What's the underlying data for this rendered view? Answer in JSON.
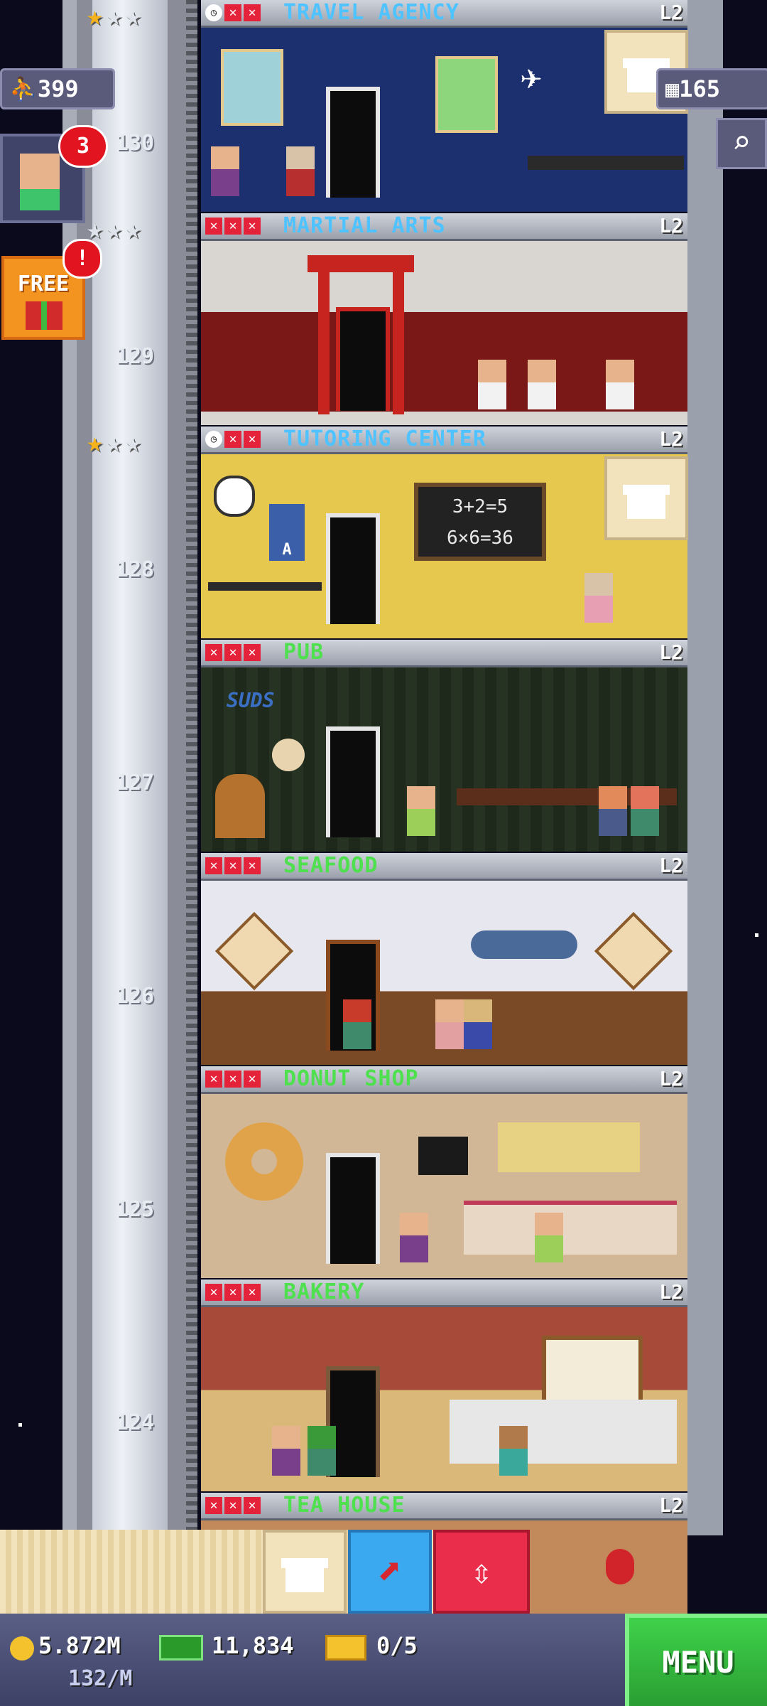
{
  "top_left": {
    "population": "399",
    "visitor_badge_count": "3",
    "free_label": "FREE",
    "free_alert": "!"
  },
  "top_right": {
    "bux_or_rooms": "165"
  },
  "floors": [
    {
      "name": "TRAVEL AGENCY",
      "level": "L2",
      "number": "130",
      "name_color": "#4fc3ff",
      "stars_gold": 1
    },
    {
      "name": "MARTIAL ARTS",
      "level": "L2",
      "number": "129",
      "name_color": "#4fc3ff",
      "stars_gold": 0
    },
    {
      "name": "TUTORING CENTER",
      "level": "L2",
      "number": "128",
      "name_color": "#4fc3ff",
      "stars_gold": 1
    },
    {
      "name": "PUB",
      "level": "L2",
      "number": "127",
      "name_color": "#4ee04e",
      "stars_gold": 0
    },
    {
      "name": "SEAFOOD",
      "level": "L2",
      "number": "126",
      "name_color": "#4ee04e",
      "stars_gold": 0
    },
    {
      "name": "DONUT SHOP",
      "level": "L2",
      "number": "125",
      "name_color": "#4ee04e",
      "stars_gold": 0
    },
    {
      "name": "BAKERY",
      "level": "L2",
      "number": "124",
      "name_color": "#4ee04e",
      "stars_gold": 0
    },
    {
      "name": "TEA HOUSE",
      "level": "L2",
      "number": "",
      "name_color": "#4ee04e",
      "stars_gold": 0
    }
  ],
  "room_signs": {
    "chalkboard_line1": "3+2=5",
    "chalkboard_line2": "6×6=36",
    "pub_sign": "SUDS",
    "poster_letter": "A"
  },
  "status": {
    "coins": "5.872M",
    "coins_rate": "132/M",
    "bux": "11,834",
    "tickets": "0/5",
    "menu_label": "MENU"
  },
  "colors": {
    "menu": "#2fb83a",
    "elevator_button": "#ea2d4b",
    "builder_button": "#3aa9ef",
    "box_button": "#f3e3bc"
  }
}
